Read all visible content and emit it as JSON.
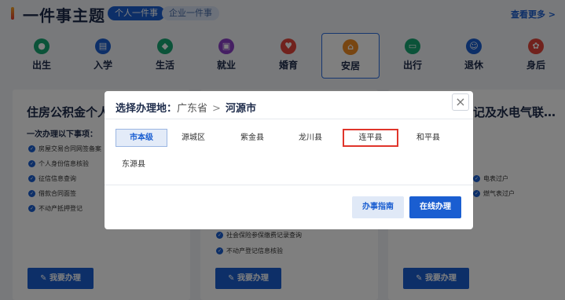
{
  "header": {
    "title": "一件事主题",
    "tabs": [
      {
        "label": "个人一件事"
      },
      {
        "label": "企业一件事"
      }
    ],
    "view_more": "查看更多 >"
  },
  "categories": [
    {
      "label": "出生",
      "icon": "baby-icon",
      "color": "#17a673"
    },
    {
      "label": "入学",
      "icon": "book-icon",
      "color": "#1a5ed1"
    },
    {
      "label": "生活",
      "icon": "life-icon",
      "color": "#17a673"
    },
    {
      "label": "就业",
      "icon": "briefcase-icon",
      "color": "#8b3fc6"
    },
    {
      "label": "婚育",
      "icon": "heart-icon",
      "color": "#e2453a"
    },
    {
      "label": "安居",
      "icon": "house-icon",
      "color": "#f08c24"
    },
    {
      "label": "出行",
      "icon": "car-icon",
      "color": "#17a673"
    },
    {
      "label": "退休",
      "icon": "person-icon",
      "color": "#1a5ed1"
    },
    {
      "label": "身后",
      "icon": "memorial-icon",
      "color": "#e2453a"
    }
  ],
  "cards": [
    {
      "title": "住房公积金个人",
      "subtitle": "一次办理以下事项：",
      "items": [
        "房屋交易合同网签备案",
        "个人身份信息核验",
        "征信信息查询",
        "借款合同面签",
        "不动产抵押登记"
      ],
      "button": "我要办理"
    },
    {
      "items": [
        "社会保险参保缴费记录查询",
        "不动产登记信息核验"
      ],
      "button": "我要办理"
    },
    {
      "title": "记及水电气联…",
      "items": [
        "电表过户",
        "燃气表过户"
      ],
      "button": "我要办理"
    }
  ],
  "dialog": {
    "title": "选择办理地：",
    "province": "广东省",
    "separator": ">",
    "city": "河源市",
    "close": "×",
    "regions": [
      "市本级",
      "源城区",
      "紫金县",
      "龙川县",
      "连平县",
      "和平县",
      "东源县"
    ],
    "selected_region": "市本级",
    "highlighted_region": "连平县",
    "guide_button": "办事指南",
    "online_button": "在线办理"
  },
  "colors": {
    "primary": "#1a5ed1",
    "highlight_border": "#e0352b"
  }
}
